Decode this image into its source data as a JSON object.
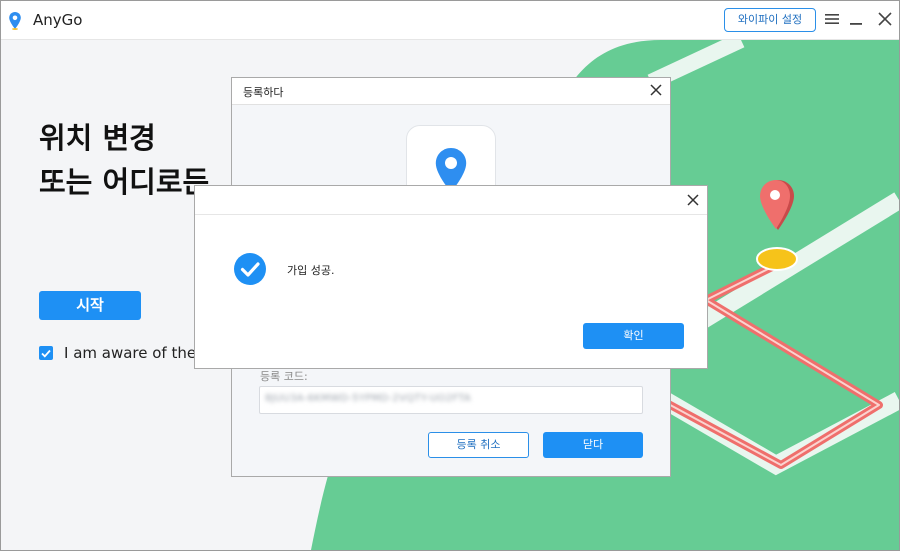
{
  "app": {
    "name": "AnyGo"
  },
  "titlebar": {
    "wifi_button": "와이파이 설정"
  },
  "main": {
    "headline_line1": "위치 변경",
    "headline_line2": "또는 어디로든",
    "start_button": "시작",
    "aware_text": "I am aware of the"
  },
  "register_dialog": {
    "title": "등록하다",
    "code_label": "등록 코드:",
    "code_value": "8JUU3A-6KMWD-5YPMD-2VQTY-UO2FTA",
    "cancel_button": "등록 취소",
    "close_button": "닫다"
  },
  "success_dialog": {
    "message": "가입 성공.",
    "confirm_button": "확인"
  },
  "colors": {
    "accent": "#1e90f4",
    "map_green": "#66cc94",
    "route_red": "#ef6f6c",
    "pin_yellow": "#f6c31a"
  }
}
